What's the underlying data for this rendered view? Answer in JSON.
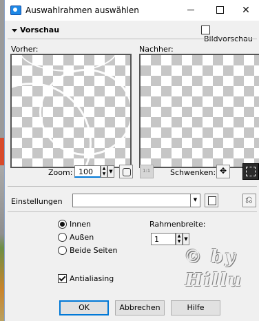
{
  "window": {
    "title": "Auswahlrahmen auswählen",
    "icon": "app-icon",
    "controls": {
      "minimize": "minimize-icon",
      "maximize": "maximize-icon",
      "close": "close-icon"
    }
  },
  "preview_header": {
    "toggle_label": "Vorschau",
    "image_preview_label": "Bildvorschau",
    "image_preview_checked": false
  },
  "panes": {
    "before_label": "Vorher:",
    "after_label": "Nachher:"
  },
  "zoom": {
    "label": "Zoom:",
    "value": "100",
    "fit_icon": "zoom-fit-icon",
    "actual_icon": "zoom-actual-size-icon",
    "actual_icon_text": "1:1"
  },
  "pan": {
    "label": "Schwenken:",
    "move_icon": "move-icon",
    "extent_icon": "selection-extent-icon"
  },
  "settings": {
    "label": "Einstellungen",
    "preset_value": "",
    "save_icon": "save-preset-icon",
    "reset_icon": "reset-icon"
  },
  "placement": {
    "options": [
      {
        "label": "Innen",
        "checked": true
      },
      {
        "label": "Außen",
        "checked": false
      },
      {
        "label": "Beide Seiten",
        "checked": false
      }
    ]
  },
  "frame_width": {
    "label": "Rahmenbreite:",
    "value": "1"
  },
  "antialiasing": {
    "label": "Antialiasing",
    "checked": true
  },
  "buttons": {
    "ok": "OK",
    "cancel": "Abbrechen",
    "help": "Hilfe"
  },
  "watermark": {
    "line1": "© by",
    "line2": "Hillu"
  },
  "colors": {
    "accent": "#0078d7",
    "dialog_bg": "#f0f0f0",
    "checker": "#c6c6c6"
  }
}
